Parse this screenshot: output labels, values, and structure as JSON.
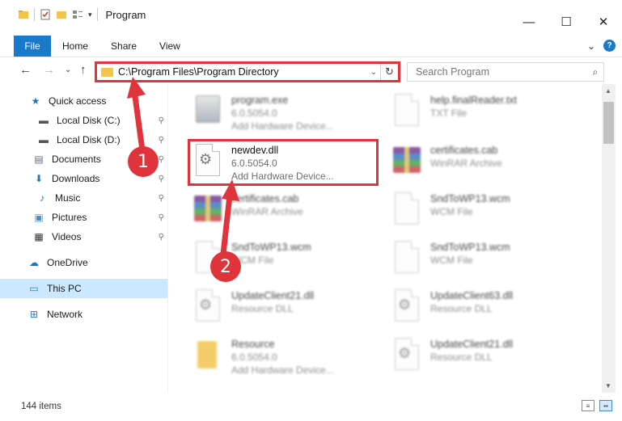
{
  "window": {
    "title": "Program",
    "minimize_glyph": "—",
    "maximize_glyph": "☐",
    "close_glyph": "✕"
  },
  "ribbon": {
    "tabs": [
      "File",
      "Home",
      "Share",
      "View"
    ],
    "expand_glyph": "⌄",
    "help_glyph": "?"
  },
  "nav": {
    "back_glyph": "←",
    "forward_glyph": "→",
    "recent_glyph": "⌄",
    "up_glyph": "↑",
    "address": "C:\\Program Files\\Program Directory",
    "chevron_glyph": "⌄",
    "refresh_glyph": "↻",
    "search_placeholder": "Search Program",
    "search_glyph": "⌕"
  },
  "sidebar": {
    "items": [
      {
        "label": "Quick access",
        "icon": "star-icon",
        "glyph": "★",
        "color": "#1f73c7",
        "pinned": false
      },
      {
        "label": "Local Disk (C:)",
        "icon": "drive-icon",
        "glyph": "▬",
        "color": "#555555",
        "pinned": true
      },
      {
        "label": "Local Disk (D:)",
        "icon": "drive-icon",
        "glyph": "▬",
        "color": "#555555",
        "pinned": true
      },
      {
        "label": "Documents",
        "icon": "documents-icon",
        "glyph": "▤",
        "color": "#5f6e80",
        "pinned": true
      },
      {
        "label": "Downloads",
        "icon": "download-icon",
        "glyph": "⬇",
        "color": "#1f73c7",
        "pinned": true
      },
      {
        "label": "Music",
        "icon": "music-icon",
        "glyph": "♪",
        "color": "#1f73c7",
        "pinned": true
      },
      {
        "label": "Pictures",
        "icon": "pictures-icon",
        "glyph": "▣",
        "color": "#4a8ac9",
        "pinned": true
      },
      {
        "label": "Videos",
        "icon": "videos-icon",
        "glyph": "▦",
        "color": "#333333",
        "pinned": true
      },
      {
        "label": "OneDrive",
        "icon": "cloud-icon",
        "glyph": "☁",
        "color": "#1f73c7",
        "pinned": false
      },
      {
        "label": "This PC",
        "icon": "computer-icon",
        "glyph": "▭",
        "color": "#2a7bc9",
        "pinned": false
      },
      {
        "label": "Network",
        "icon": "network-icon",
        "glyph": "⊞",
        "color": "#2a7bc9",
        "pinned": false
      }
    ],
    "pin_glyph": "⚲"
  },
  "files": [
    {
      "name": "program.exe",
      "line1": "6.0.5054.0",
      "line2": "Add Hardware Device...",
      "icon": "exe-icon",
      "blur": true
    },
    {
      "name": "help.finalReader.txt",
      "line1": "TXT File",
      "line2": "",
      "icon": "text-file-icon",
      "blur": true
    },
    {
      "name": "newdev.dll",
      "line1": "6.0.5054.0",
      "line2": "Add Hardware Device...",
      "icon": "dll-file-icon",
      "blur": false
    },
    {
      "name": "certificates.cab",
      "line1": "WinRAR Archive",
      "line2": "",
      "icon": "winrar-archive-icon",
      "blur": true
    },
    {
      "name": "certificates.cab",
      "line1": "WinRAR Archive",
      "line2": "",
      "icon": "winrar-archive-icon",
      "blur": true
    },
    {
      "name": "SndToWP13.wcm",
      "line1": "WCM File",
      "line2": "",
      "icon": "blank-file-icon",
      "blur": true
    },
    {
      "name": "SndToWP13.wcm",
      "line1": "WCM File",
      "line2": "",
      "icon": "blank-file-icon",
      "blur": true
    },
    {
      "name": "SndToWP13.wcm",
      "line1": "WCM File",
      "line2": "",
      "icon": "blank-file-icon",
      "blur": true
    },
    {
      "name": "UpdateClient21.dll",
      "line1": "Resource DLL",
      "line2": "",
      "icon": "dll-file-icon",
      "blur": true
    },
    {
      "name": "UpdateClient63.dll",
      "line1": "Resource DLL",
      "line2": "",
      "icon": "dll-file-icon",
      "blur": true
    },
    {
      "name": "Resource",
      "line1": "6.0.5054.0",
      "line2": "Add Hardware Device...",
      "icon": "folder-icon",
      "blur": true
    },
    {
      "name": "UpdateClient21.dll",
      "line1": "Resource DLL",
      "line2": "",
      "icon": "dll-file-icon",
      "blur": true
    }
  ],
  "status": {
    "item_count": "144 items"
  },
  "annotations": {
    "step1": "1",
    "step2": "2",
    "accent_color": "#e0343c"
  },
  "colors": {
    "file_tab": "#1979ca",
    "selection": "#cce8ff",
    "folder": "#f3c64b"
  }
}
